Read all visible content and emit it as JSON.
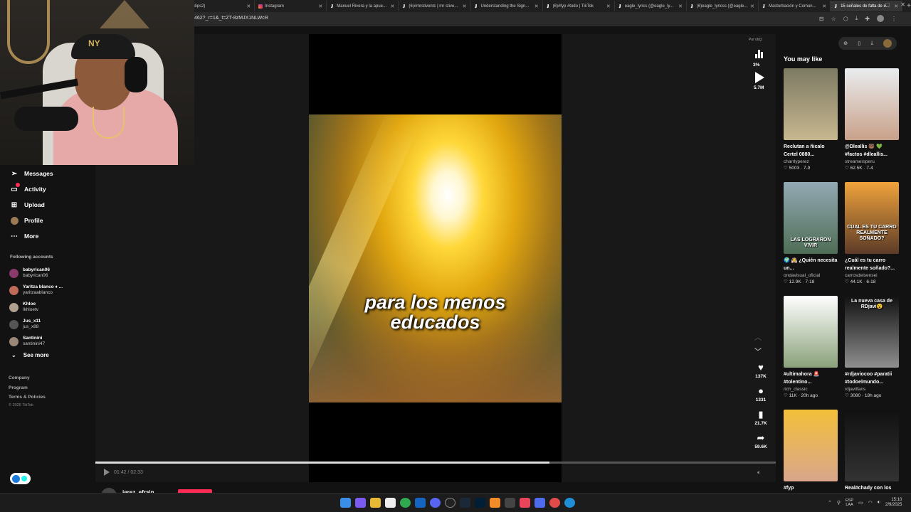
{
  "browser": {
    "tabs": [
      {
        "label": "clips2)",
        "icon": "tiktok"
      },
      {
        "label": "Instagram",
        "icon": "instagram"
      },
      {
        "label": "Manuel Rivera y la apue...",
        "icon": "tiktok"
      },
      {
        "label": "(6)#mrstiventc | mr stive...",
        "icon": "tiktok"
      },
      {
        "label": "Understanding the Sign...",
        "icon": "tiktok"
      },
      {
        "label": "(6)#fyp #todo | TikTok",
        "icon": "tiktok"
      },
      {
        "label": "eagle_lyrics (@eagle_ly...",
        "icon": "tiktok"
      },
      {
        "label": "(6)eagle_lyricss (@eagle...",
        "icon": "tiktok"
      },
      {
        "label": "Masturbación y Comun...",
        "icon": "tiktok"
      },
      {
        "label": "15 señales de falta de e...",
        "icon": "tiktok"
      }
    ],
    "new_tab": "+",
    "url": "462?_r=1&_t=ZT-8zMJX1NLWcR",
    "window_controls": [
      "–",
      "□",
      "✕"
    ]
  },
  "sidebar": {
    "nav": [
      {
        "label": "Messages",
        "icon": "send-icon"
      },
      {
        "label": "Activity",
        "icon": "inbox-icon"
      },
      {
        "label": "Upload",
        "icon": "plus-square-icon"
      },
      {
        "label": "Profile",
        "icon": "avatar-icon"
      },
      {
        "label": "More",
        "icon": "dots-icon"
      }
    ],
    "following_title": "Following accounts",
    "following": [
      {
        "name": "babyrican06",
        "handle": "babyrican06"
      },
      {
        "name": "Yaritza blanco ♦ ...",
        "handle": "yaritzaablanco"
      },
      {
        "name": "Khloe",
        "handle": "lkhloetv"
      },
      {
        "name": "Jus_x11",
        "handle": "jus_x88"
      },
      {
        "name": "Santinini",
        "handle": "santinini47"
      }
    ],
    "see_more": "See more",
    "footer": [
      "Company",
      "Program",
      "Terms & Policies"
    ],
    "copyright": "© 2025 TikTok"
  },
  "video": {
    "caption_line1": "para los menos",
    "caption_line2": "educados",
    "time": "01:42 / 02:33",
    "progress": 0.667,
    "author": "jerez_efrain"
  },
  "actions": {
    "stats_label": "Por otiQ",
    "percent": "3%",
    "plays": "5.7M",
    "likes": "137K",
    "comments": "1331",
    "saves": "21.7K",
    "shares": "59.6K"
  },
  "recommendations": {
    "title": "You may like",
    "items": [
      {
        "title": "Reclutan a ñicalo Certel 0880...",
        "author": "charrlyperez",
        "stats": "♡ 5003 · 7-9",
        "overlay": "",
        "colors": [
          "#7d7a63",
          "#c7b78f"
        ]
      },
      {
        "title": "@Dleallis 🐻 💚 #factos #dleallis...",
        "author": "streamersperu",
        "stats": "♡ 62.5K · 7-4",
        "overlay": "",
        "colors": [
          "#e9ecef",
          "#c9a18a"
        ]
      },
      {
        "title": "🌍 👰 ¿Quién necesita un...",
        "author": "ondavisual_oficial",
        "stats": "♡ 12.9K · 7-18",
        "overlay": "LAS LOGRARON VIVIR",
        "colors": [
          "#93a9b4",
          "#4e6d55"
        ]
      },
      {
        "title": "¿Cuál es tu carro realmente soñado?...",
        "author": "carrosdelsensei",
        "stats": "♡ 44.1K · 6-18",
        "overlay": "CUAL ES TU CARRO REALMENTE SOÑADO?",
        "colors": [
          "#f0a33b",
          "#5c3b27"
        ]
      },
      {
        "title": "#ultimahora 🚨 #tolentino...",
        "author": "rich_classic",
        "stats": "♡ 11K · 20h ago",
        "overlay": "",
        "colors": [
          "#ffffff",
          "#8aa17a"
        ]
      },
      {
        "title": "#rdjaviocoo #paratii #todoelmundo...",
        "author": "rdjavilfans",
        "stats": "♡ 3080 · 18h ago",
        "overlay": "La nueva casa de RDjavi😮",
        "colors": [
          "#111111",
          "#8f8f8f"
        ]
      },
      {
        "title": "#fyp",
        "author": "",
        "stats": "",
        "overlay": "",
        "colors": [
          "#f3c03a",
          "#d9a68c"
        ]
      },
      {
        "title": "Real#chady con los",
        "author": "",
        "stats": "",
        "overlay": "",
        "colors": [
          "#111111",
          "#333333"
        ]
      }
    ]
  },
  "taskbar": {
    "lang": "ESP\nLAA",
    "time": "15:10",
    "date": "2/9/2025"
  },
  "colors": {
    "accent": "#fe2c55",
    "bg": "#121212"
  }
}
